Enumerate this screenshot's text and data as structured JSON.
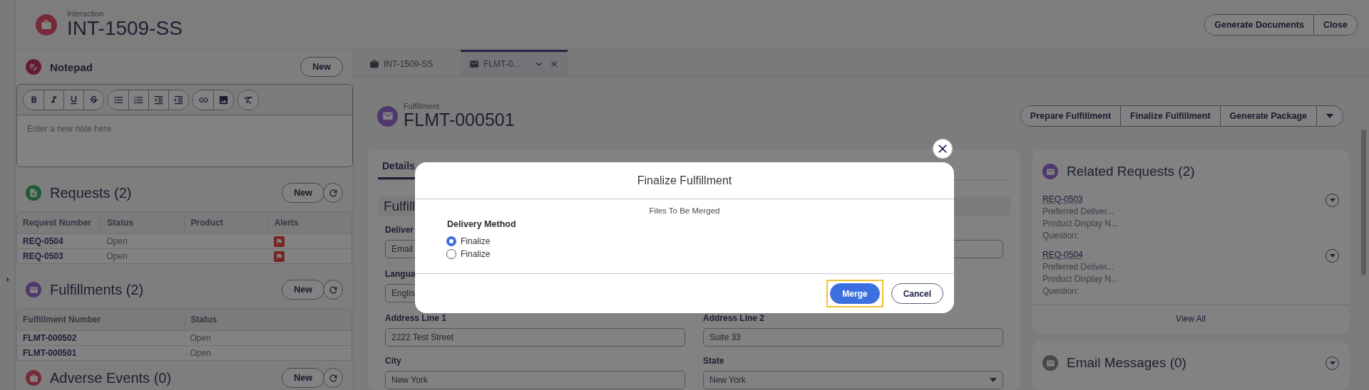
{
  "header": {
    "subtitle": "Interaction",
    "title": "INT-1509-SS",
    "actions": [
      "Generate Documents",
      "Close"
    ]
  },
  "notepad": {
    "title": "Notepad",
    "new_button": "New",
    "placeholder": "Enter a new note here"
  },
  "requests": {
    "title": "Requests (2)",
    "new_button": "New",
    "columns": [
      "Request Number",
      "Status",
      "Product",
      "Alerts"
    ],
    "rows": [
      {
        "number": "REQ-0504",
        "status": "Open",
        "alert": true
      },
      {
        "number": "REQ-0503",
        "status": "Open",
        "alert": true
      }
    ]
  },
  "fulfillments": {
    "title": "Fulfillments (2)",
    "new_button": "New",
    "columns": [
      "Fulfillment Number",
      "Status"
    ],
    "rows": [
      {
        "number": "FLMT-000502",
        "status": "Open"
      },
      {
        "number": "FLMT-000501",
        "status": "Open"
      }
    ]
  },
  "adverse_events": {
    "title": "Adverse Events (0)",
    "new_button": "New"
  },
  "tabs": [
    {
      "label": "INT-1509-SS",
      "kind": "interaction",
      "selected": false
    },
    {
      "label": "FLMT-0...",
      "kind": "fulfillment",
      "selected": true
    }
  ],
  "record": {
    "subtitle": "Fulfillment",
    "title": "FLMT-000501",
    "actions": [
      "Prepare Fulfillment",
      "Finalize Fulfillment",
      "Generate Package"
    ]
  },
  "details": {
    "tab": "Details",
    "section": "Fulfill",
    "rows": [
      {
        "left": {
          "label": "Deliver",
          "value": "Email",
          "kind": "text"
        },
        "right": {
          "kind": "text"
        }
      },
      {
        "left": {
          "label": "Langua",
          "value": "Englis",
          "kind": "text"
        },
        "right": {
          "kind": "hidden"
        }
      },
      {
        "left": {
          "label": "Address Line 1",
          "value": "2222 Test Street",
          "kind": "text"
        },
        "right": {
          "label": "Address Line 2",
          "value": "Suite 33",
          "kind": "text"
        }
      },
      {
        "left": {
          "label": "City",
          "value": "New York",
          "kind": "text"
        },
        "right": {
          "label": "State",
          "value": "New York",
          "kind": "select"
        }
      }
    ]
  },
  "related_requests": {
    "title": "Related Requests (2)",
    "view_all": "View All",
    "items": [
      {
        "link": "REQ-0503",
        "lines": [
          "Preferred Deliver...",
          "Product Display N...",
          "Question:"
        ]
      },
      {
        "link": "REQ-0504",
        "lines": [
          "Preferred Deliver...",
          "Product Display N...",
          "Question:"
        ]
      }
    ]
  },
  "email_messages": {
    "title": "Email Messages (0)"
  },
  "modal": {
    "title": "Finalize Fulfillment",
    "subtitle": "Files To Be Merged",
    "group_label": "Delivery Method",
    "options": [
      {
        "label": "Finalize",
        "selected": true
      },
      {
        "label": "Finalize",
        "selected": false
      }
    ],
    "buttons": [
      {
        "label": "Merge",
        "kind": "primary",
        "focused": true
      },
      {
        "label": "Cancel",
        "kind": "secondary",
        "focused": false
      }
    ]
  }
}
